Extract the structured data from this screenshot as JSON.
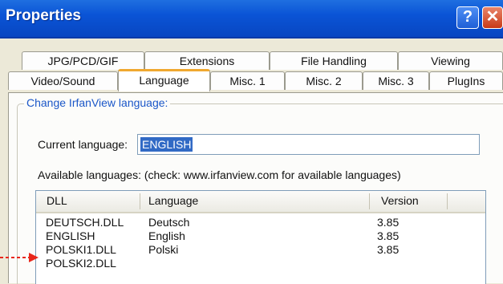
{
  "window": {
    "title": "Properties",
    "help_glyph": "?",
    "close_glyph": "✕"
  },
  "tabs": {
    "row1": [
      "JPG/PCD/GIF",
      "Extensions",
      "File Handling",
      "Viewing"
    ],
    "row2": [
      "Video/Sound",
      "Language",
      "Misc. 1",
      "Misc. 2",
      "Misc. 3",
      "PlugIns"
    ],
    "active": "Language"
  },
  "group": {
    "label": "Change IrfanView language:"
  },
  "current": {
    "label": "Current language:",
    "value": "ENGLISH"
  },
  "available": {
    "label": "Available languages: (check: www.irfanview.com for available languages)"
  },
  "list": {
    "columns": [
      "DLL",
      "Language",
      "Version"
    ],
    "rows": [
      {
        "dll": "DEUTSCH.DLL",
        "language": "Deutsch",
        "version": "3.85"
      },
      {
        "dll": "ENGLISH",
        "language": "English",
        "version": "3.85"
      },
      {
        "dll": "POLSKI1.DLL",
        "language": "Polski",
        "version": "3.85"
      },
      {
        "dll": "POLSKI2.DLL",
        "language": "",
        "version": ""
      }
    ]
  },
  "annotation": {
    "arrow_color": "#e8271b",
    "icon": "dashed-arrow-icon"
  }
}
